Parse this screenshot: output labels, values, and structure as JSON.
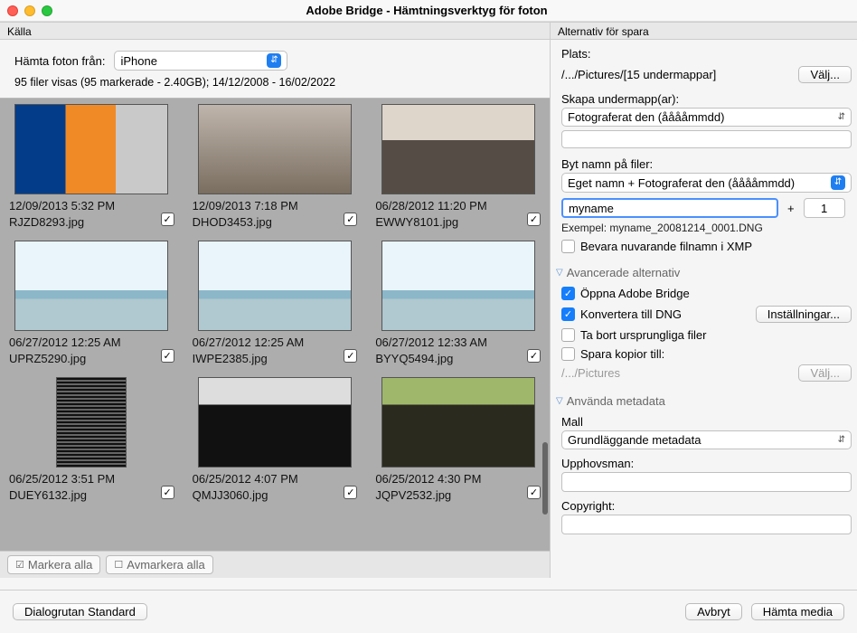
{
  "title": "Adobe Bridge - Hämtningsverktyg för foton",
  "left": {
    "section": "Källa",
    "source_label": "Hämta foton från:",
    "source_value": "iPhone",
    "status": "95 filer visas (95 markerade - 2.40GB); 14/12/2008 - 16/02/2022",
    "select_all": "Markera alla",
    "deselect_all": "Avmarkera alla"
  },
  "thumbs": [
    {
      "date": "12/09/2013 5:32 PM",
      "file": "RJZD8293.jpg",
      "cls": "img-ppl"
    },
    {
      "date": "12/09/2013 7:18 PM",
      "file": "DHOD3453.jpg",
      "cls": "img-grp"
    },
    {
      "date": "06/28/2012 11:20 PM",
      "file": "EWWY8101.jpg",
      "cls": "img-land"
    },
    {
      "date": "06/27/2012 12:25 AM",
      "file": "UPRZ5290.jpg",
      "cls": "img-ice"
    },
    {
      "date": "06/27/2012 12:25 AM",
      "file": "IWPE2385.jpg",
      "cls": "img-ice"
    },
    {
      "date": "06/27/2012 12:33 AM",
      "file": "BYYQ5494.jpg",
      "cls": "img-ice"
    },
    {
      "date": "06/25/2012 3:51 PM",
      "file": "DUEY6132.jpg",
      "cls": "img-fall-g"
    },
    {
      "date": "06/25/2012 4:07 PM",
      "file": "QMJJ3060.jpg",
      "cls": "img-fall-bw"
    },
    {
      "date": "06/25/2012 4:30 PM",
      "file": "JQPV2532.jpg",
      "cls": "img-fall-c"
    }
  ],
  "right": {
    "section": "Alternativ för spara",
    "location_label": "Plats:",
    "location_path": "/.../Pictures/[15 undermappar]",
    "choose": "Välj...",
    "subfolder_label": "Skapa undermapp(ar):",
    "subfolder_value": "Fotograferat den (ååååmmdd)",
    "rename_label": "Byt namn på filer:",
    "rename_value": "Eget namn + Fotograferat den (ååååmmdd)",
    "name_value": "myname",
    "seq_value": "1",
    "example_label": "Exempel: myname_20081214_0001.DNG",
    "preserve_xmp": "Bevara nuvarande filnamn i XMP",
    "advanced_header": "Avancerade alternativ",
    "open_bridge": "Öppna Adobe Bridge",
    "convert_dng": "Konvertera till DNG",
    "settings": "Inställningar...",
    "delete_orig": "Ta bort ursprungliga filer",
    "save_copies": "Spara kopior till:",
    "copies_path": "/.../Pictures",
    "choose2": "Välj...",
    "metadata_header": "Använda metadata",
    "template_label": "Mall",
    "template_value": "Grundläggande metadata",
    "creator_label": "Upphovsman:",
    "copyright_label": "Copyright:"
  },
  "footer": {
    "dialog_std": "Dialogrutan Standard",
    "cancel": "Avbryt",
    "get_media": "Hämta media"
  }
}
